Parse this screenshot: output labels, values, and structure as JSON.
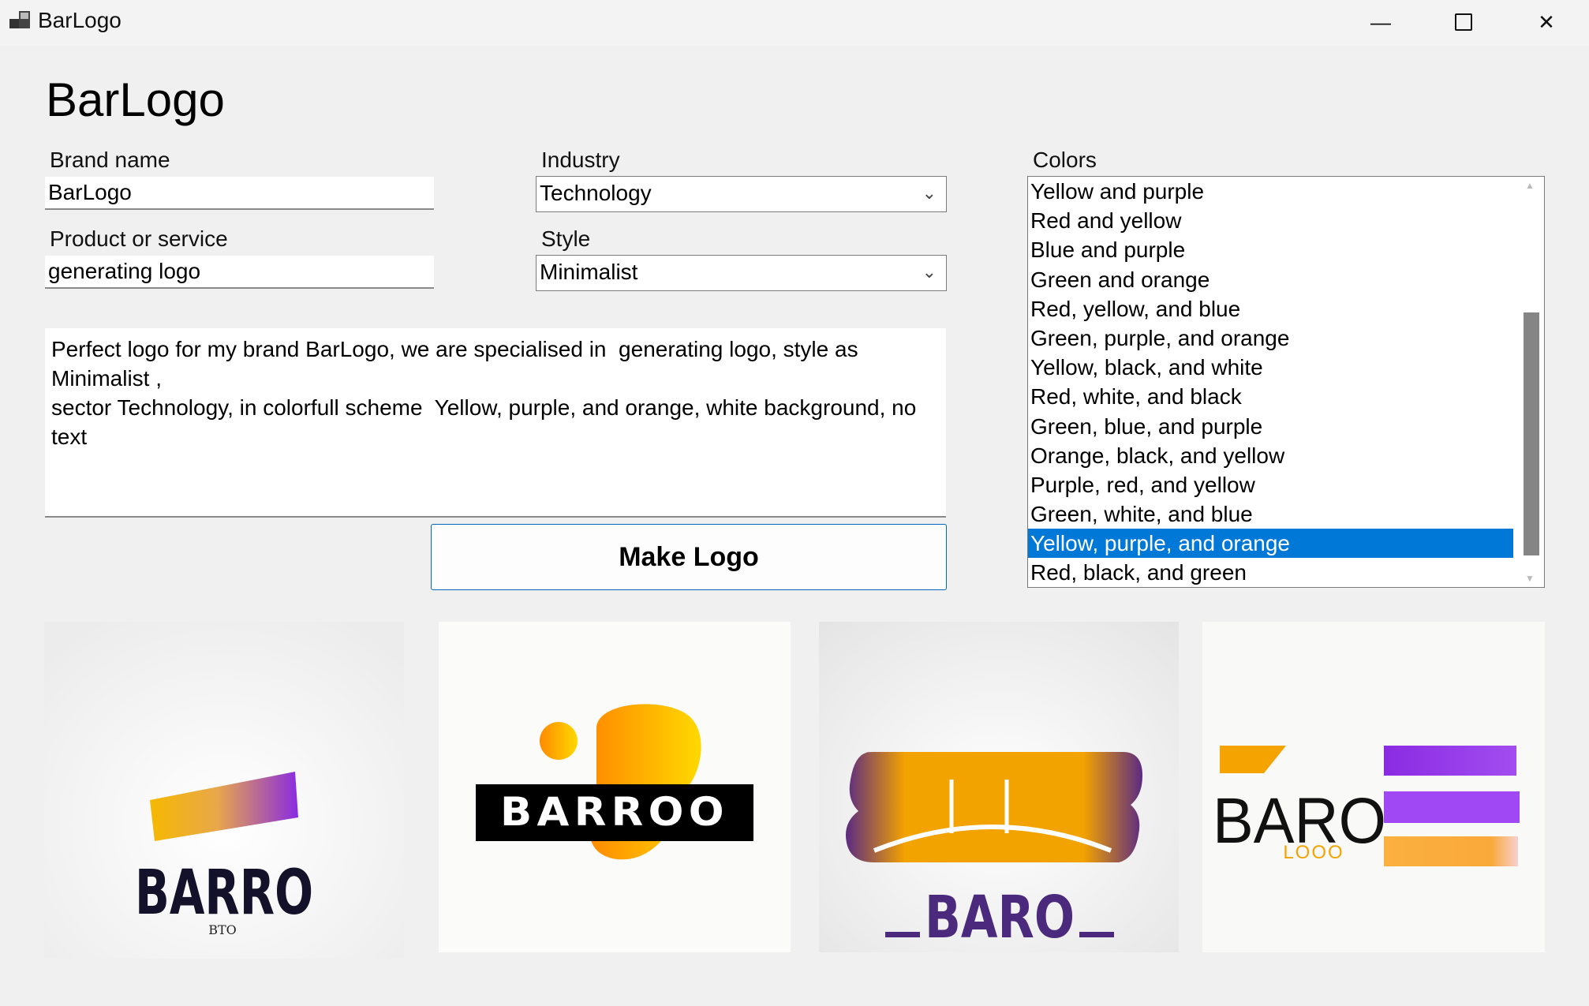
{
  "window": {
    "title": "BarLogo"
  },
  "heading": "BarLogo",
  "form": {
    "brand_name_label": "Brand name",
    "brand_name_value": "BarLogo",
    "product_label": "Product or service",
    "product_value": "generating logo",
    "industry_label": "Industry",
    "industry_value": "Technology",
    "style_label": "Style",
    "style_value": "Minimalist",
    "colors_label": "Colors",
    "prompt_text": "Perfect logo for my brand BarLogo, we are specialised in  generating logo, style as Minimalist ,\nsector Technology, in colorfull scheme  Yellow, purple, and orange, white background, no text",
    "make_button_label": "Make Logo"
  },
  "colors_list": {
    "items": [
      "Yellow and purple",
      "Red and yellow",
      "Blue and purple",
      "Green and orange",
      "Red, yellow, and blue",
      "Green, purple, and orange",
      "Yellow, black, and white",
      "Red, white, and black",
      "Green, blue, and purple",
      "Orange, black, and yellow",
      "Purple, red, and yellow",
      "Green, white, and blue",
      "Yellow, purple, and orange",
      "Red, black, and green"
    ],
    "selected_index": 12
  },
  "logos": {
    "logo1": {
      "main": "BARRO",
      "sub": "BTO"
    },
    "logo2": {
      "main": "BARROO"
    },
    "logo3": {
      "main": "BARO"
    },
    "logo4": {
      "main": "BARO",
      "sub": "LOOO"
    }
  },
  "accent_color": "#0078d7",
  "icons": [
    "app-icon",
    "minimize-icon",
    "maximize-icon",
    "close-icon",
    "chevron-down-icon",
    "scroll-up-icon",
    "scroll-down-icon"
  ]
}
